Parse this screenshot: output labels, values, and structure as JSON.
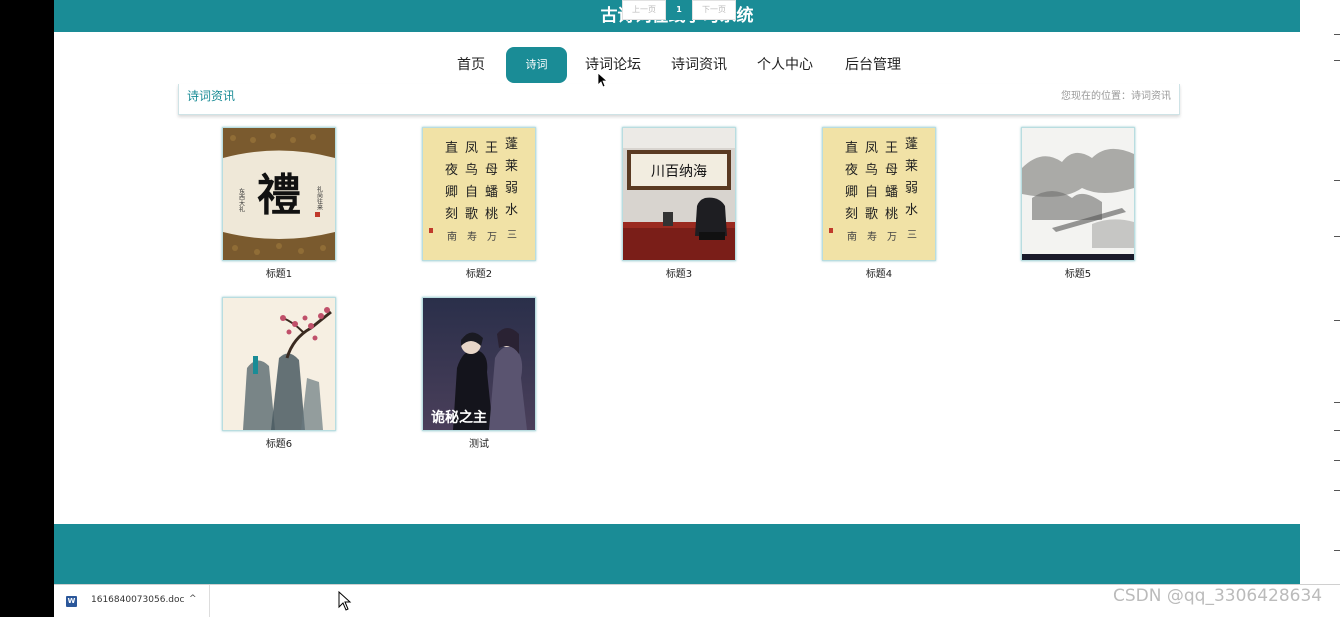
{
  "site": {
    "title": "古诗词在线学习系统"
  },
  "nav": {
    "items": [
      {
        "label": "首页"
      },
      {
        "label": "诗词"
      },
      {
        "label": "诗词论坛"
      },
      {
        "label": "诗词资讯"
      },
      {
        "label": "个人中心"
      },
      {
        "label": "后台管理"
      }
    ],
    "active_index": 1
  },
  "section": {
    "title": "诗词资讯",
    "breadcrumb": "您现在的位置：诗词资讯"
  },
  "cards": [
    {
      "caption": "标题1",
      "image": "calligraphy-li-scroll"
    },
    {
      "caption": "标题2",
      "image": "calligraphy-poem-yellow"
    },
    {
      "caption": "标题3",
      "image": "office-calligraphy-plaque"
    },
    {
      "caption": "标题4",
      "image": "calligraphy-poem-yellow"
    },
    {
      "caption": "标题5",
      "image": "ink-landscape"
    },
    {
      "caption": "标题6",
      "image": "plum-blossom-rocks"
    },
    {
      "caption": "测试",
      "image": "anime-cover",
      "overlay_text": "诡秘之主"
    }
  ],
  "pagination": {
    "prev": "上一页",
    "current": "1",
    "next": "下一页"
  },
  "download_bar": {
    "file_name": "1616840073056.doc",
    "icon": "word-doc-icon",
    "chevron": "^"
  },
  "watermark": "CSDN @qq_3306428634",
  "colors": {
    "primary": "#1a8c96",
    "page_bg": "#ffffff"
  }
}
